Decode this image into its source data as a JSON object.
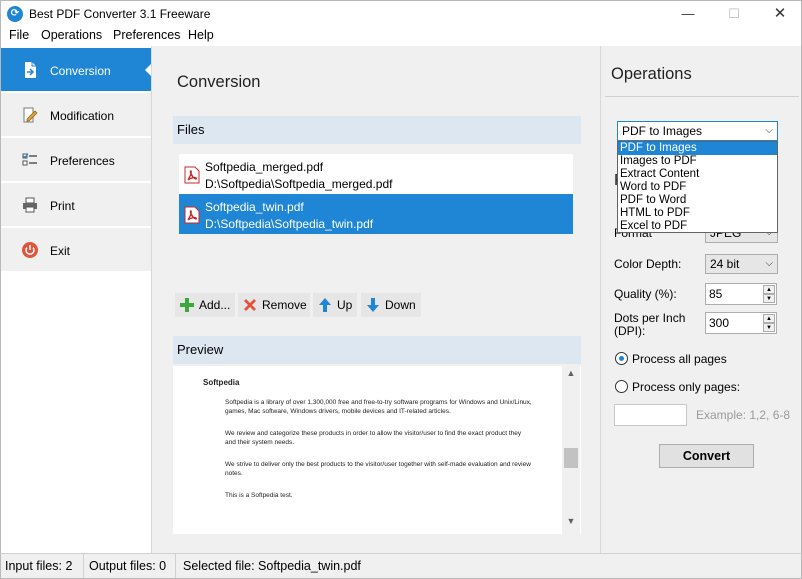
{
  "window": {
    "title": "Best PDF Converter 3.1 Freeware",
    "min": "—",
    "max": "☐",
    "close": "✕"
  },
  "menu": [
    "File",
    "Operations",
    "Preferences",
    "Help"
  ],
  "sidebar": {
    "items": [
      {
        "label": "Conversion",
        "icon": "conversion-icon",
        "active": true
      },
      {
        "label": "Modification",
        "icon": "modification-icon"
      },
      {
        "label": "Preferences",
        "icon": "preferences-icon"
      },
      {
        "label": "Print",
        "icon": "printer-icon"
      },
      {
        "label": "Exit",
        "icon": "power-icon"
      }
    ]
  },
  "main": {
    "title": "Conversion",
    "files_header": "Files",
    "files": [
      {
        "name": "Softpedia_merged.pdf",
        "path": "D:\\Softpedia\\Softpedia_merged.pdf",
        "selected": false
      },
      {
        "name": "Softpedia_twin.pdf",
        "path": "D:\\Softpedia\\Softpedia_twin.pdf",
        "selected": true
      }
    ],
    "toolbar": {
      "add": "Add...",
      "remove": "Remove",
      "up": "Up",
      "down": "Down"
    },
    "preview_header": "Preview",
    "preview_doc": {
      "title": "Softpedia",
      "paragraphs": [
        "Softpedia is a library of over 1,300,000 free and free-to-try software programs for Windows and Unix/Linux, games, Mac software, Windows drivers, mobile devices and IT-related articles.",
        "We review and categorize these products in order to allow the visitor/user to find the exact product they and their system needs.",
        "We strive to deliver only the best products to the visitor/user together with self-made evaluation and review notes.",
        "This is a Softpedia test."
      ]
    }
  },
  "operations": {
    "title": "Operations",
    "operation_value": "PDF to Images",
    "dropdown_options": [
      "PDF to Images",
      "Images to PDF",
      "Extract Content",
      "Word to PDF",
      "PDF to Word",
      "HTML to PDF",
      "Excel to PDF"
    ],
    "params_heading_partial": "P",
    "format_label": "Format",
    "format_value": "JPEG",
    "color_depth_label": "Color Depth:",
    "color_depth_value": "24 bit",
    "quality_label": "Quality (%):",
    "quality_value": "85",
    "dpi_label_1": "Dots per Inch",
    "dpi_label_2": "(DPI):",
    "dpi_value": "300",
    "process_all": "Process all pages",
    "process_only": "Process only pages:",
    "pages_value": "",
    "example": "Example: 1,2, 6-8",
    "convert": "Convert"
  },
  "status": {
    "input": "Input files: 2",
    "output": "Output files: 0",
    "selected": "Selected file: Softpedia_twin.pdf"
  },
  "colors": {
    "accent": "#1f86d6",
    "section_head": "#dde7f2",
    "panel": "#f0f0f0"
  }
}
